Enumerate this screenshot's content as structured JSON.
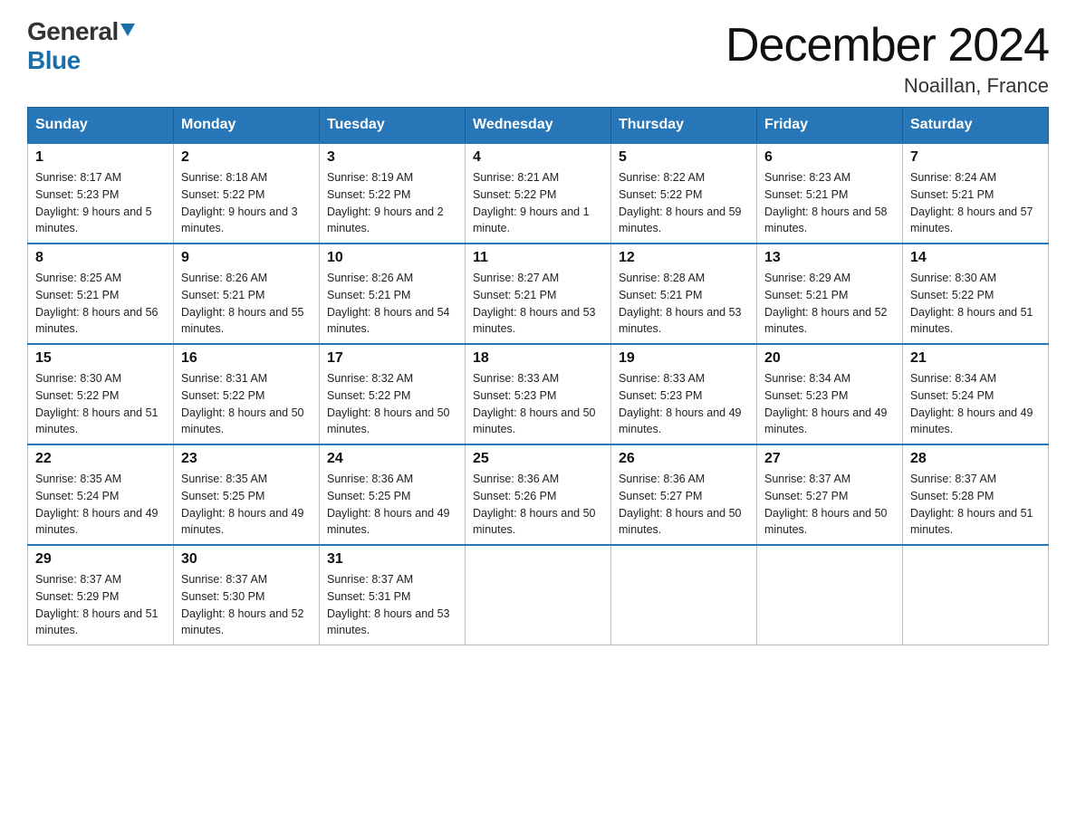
{
  "logo": {
    "general": "General",
    "blue": "Blue"
  },
  "title": {
    "month_year": "December 2024",
    "location": "Noaillan, France"
  },
  "days_of_week": [
    "Sunday",
    "Monday",
    "Tuesday",
    "Wednesday",
    "Thursday",
    "Friday",
    "Saturday"
  ],
  "weeks": [
    [
      {
        "day": "1",
        "sunrise": "8:17 AM",
        "sunset": "5:23 PM",
        "daylight": "9 hours and 5 minutes."
      },
      {
        "day": "2",
        "sunrise": "8:18 AM",
        "sunset": "5:22 PM",
        "daylight": "9 hours and 3 minutes."
      },
      {
        "day": "3",
        "sunrise": "8:19 AM",
        "sunset": "5:22 PM",
        "daylight": "9 hours and 2 minutes."
      },
      {
        "day": "4",
        "sunrise": "8:21 AM",
        "sunset": "5:22 PM",
        "daylight": "9 hours and 1 minute."
      },
      {
        "day": "5",
        "sunrise": "8:22 AM",
        "sunset": "5:22 PM",
        "daylight": "8 hours and 59 minutes."
      },
      {
        "day": "6",
        "sunrise": "8:23 AM",
        "sunset": "5:21 PM",
        "daylight": "8 hours and 58 minutes."
      },
      {
        "day": "7",
        "sunrise": "8:24 AM",
        "sunset": "5:21 PM",
        "daylight": "8 hours and 57 minutes."
      }
    ],
    [
      {
        "day": "8",
        "sunrise": "8:25 AM",
        "sunset": "5:21 PM",
        "daylight": "8 hours and 56 minutes."
      },
      {
        "day": "9",
        "sunrise": "8:26 AM",
        "sunset": "5:21 PM",
        "daylight": "8 hours and 55 minutes."
      },
      {
        "day": "10",
        "sunrise": "8:26 AM",
        "sunset": "5:21 PM",
        "daylight": "8 hours and 54 minutes."
      },
      {
        "day": "11",
        "sunrise": "8:27 AM",
        "sunset": "5:21 PM",
        "daylight": "8 hours and 53 minutes."
      },
      {
        "day": "12",
        "sunrise": "8:28 AM",
        "sunset": "5:21 PM",
        "daylight": "8 hours and 53 minutes."
      },
      {
        "day": "13",
        "sunrise": "8:29 AM",
        "sunset": "5:21 PM",
        "daylight": "8 hours and 52 minutes."
      },
      {
        "day": "14",
        "sunrise": "8:30 AM",
        "sunset": "5:22 PM",
        "daylight": "8 hours and 51 minutes."
      }
    ],
    [
      {
        "day": "15",
        "sunrise": "8:30 AM",
        "sunset": "5:22 PM",
        "daylight": "8 hours and 51 minutes."
      },
      {
        "day": "16",
        "sunrise": "8:31 AM",
        "sunset": "5:22 PM",
        "daylight": "8 hours and 50 minutes."
      },
      {
        "day": "17",
        "sunrise": "8:32 AM",
        "sunset": "5:22 PM",
        "daylight": "8 hours and 50 minutes."
      },
      {
        "day": "18",
        "sunrise": "8:33 AM",
        "sunset": "5:23 PM",
        "daylight": "8 hours and 50 minutes."
      },
      {
        "day": "19",
        "sunrise": "8:33 AM",
        "sunset": "5:23 PM",
        "daylight": "8 hours and 49 minutes."
      },
      {
        "day": "20",
        "sunrise": "8:34 AM",
        "sunset": "5:23 PM",
        "daylight": "8 hours and 49 minutes."
      },
      {
        "day": "21",
        "sunrise": "8:34 AM",
        "sunset": "5:24 PM",
        "daylight": "8 hours and 49 minutes."
      }
    ],
    [
      {
        "day": "22",
        "sunrise": "8:35 AM",
        "sunset": "5:24 PM",
        "daylight": "8 hours and 49 minutes."
      },
      {
        "day": "23",
        "sunrise": "8:35 AM",
        "sunset": "5:25 PM",
        "daylight": "8 hours and 49 minutes."
      },
      {
        "day": "24",
        "sunrise": "8:36 AM",
        "sunset": "5:25 PM",
        "daylight": "8 hours and 49 minutes."
      },
      {
        "day": "25",
        "sunrise": "8:36 AM",
        "sunset": "5:26 PM",
        "daylight": "8 hours and 50 minutes."
      },
      {
        "day": "26",
        "sunrise": "8:36 AM",
        "sunset": "5:27 PM",
        "daylight": "8 hours and 50 minutes."
      },
      {
        "day": "27",
        "sunrise": "8:37 AM",
        "sunset": "5:27 PM",
        "daylight": "8 hours and 50 minutes."
      },
      {
        "day": "28",
        "sunrise": "8:37 AM",
        "sunset": "5:28 PM",
        "daylight": "8 hours and 51 minutes."
      }
    ],
    [
      {
        "day": "29",
        "sunrise": "8:37 AM",
        "sunset": "5:29 PM",
        "daylight": "8 hours and 51 minutes."
      },
      {
        "day": "30",
        "sunrise": "8:37 AM",
        "sunset": "5:30 PM",
        "daylight": "8 hours and 52 minutes."
      },
      {
        "day": "31",
        "sunrise": "8:37 AM",
        "sunset": "5:31 PM",
        "daylight": "8 hours and 53 minutes."
      },
      null,
      null,
      null,
      null
    ]
  ]
}
